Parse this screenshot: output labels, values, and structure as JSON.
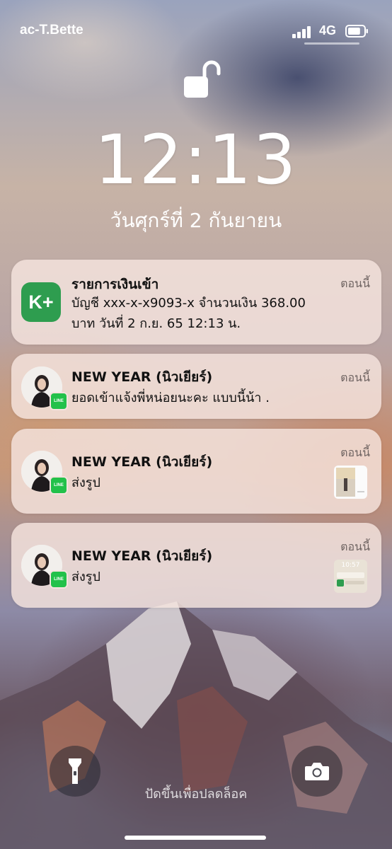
{
  "status_bar": {
    "carrier": "ac-T.Bette",
    "network": "4G",
    "signal_bars": 4,
    "battery_level": 0.8,
    "icons": [
      "signal-bars-icon",
      "battery-icon"
    ]
  },
  "lock_screen": {
    "time": "12:13",
    "date": "วันศุกร์ที่ 2 กันยายน",
    "lock_icon": "unlocked-padlock-icon"
  },
  "notifications": [
    {
      "app": "K+",
      "icon": "kplus-app-icon",
      "title": "รายการเงินเข้า",
      "time": "ตอนนี้",
      "body": [
        "บัญชี xxx-x-x9093-x  จำนวนเงิน 368.00",
        "บาท  วันที่ 2 ก.ย. 65  12:13 น."
      ]
    },
    {
      "app": "LINE",
      "badge": "LINE",
      "icon": "contact-avatar",
      "title": "NEW YEAR (นิวเยียร์)",
      "time": "ตอนนี้",
      "body": [
        "ยอดเข้าแจ้งพี่หน่อยนะคะ แบบนี้น้า ."
      ]
    },
    {
      "app": "LINE",
      "badge": "LINE",
      "icon": "contact-avatar",
      "title": "NEW YEAR (นิวเยียร์)",
      "time": "ตอนนี้",
      "body": [
        "ส่งรูป"
      ],
      "thumbnail": "photo-thumbnail"
    },
    {
      "app": "LINE",
      "badge": "LINE",
      "icon": "contact-avatar",
      "title": "NEW YEAR (นิวเยียร์)",
      "time": "ตอนนี้",
      "body": [
        "ส่งรูป"
      ],
      "thumbnail": "screenshot-thumbnail",
      "thumbnail_text": "10:57"
    }
  ],
  "bottom": {
    "flashlight_icon": "flashlight-icon",
    "camera_icon": "camera-icon",
    "unlock_hint": "ปัดขึ้นเพื่อปลดล็อค"
  },
  "colors": {
    "kplus_green": "#2e9d4f",
    "line_green": "#22c14a",
    "notification_bg": "#f5e4de",
    "text_primary": "#111111",
    "text_secondary": "#6f6462"
  }
}
